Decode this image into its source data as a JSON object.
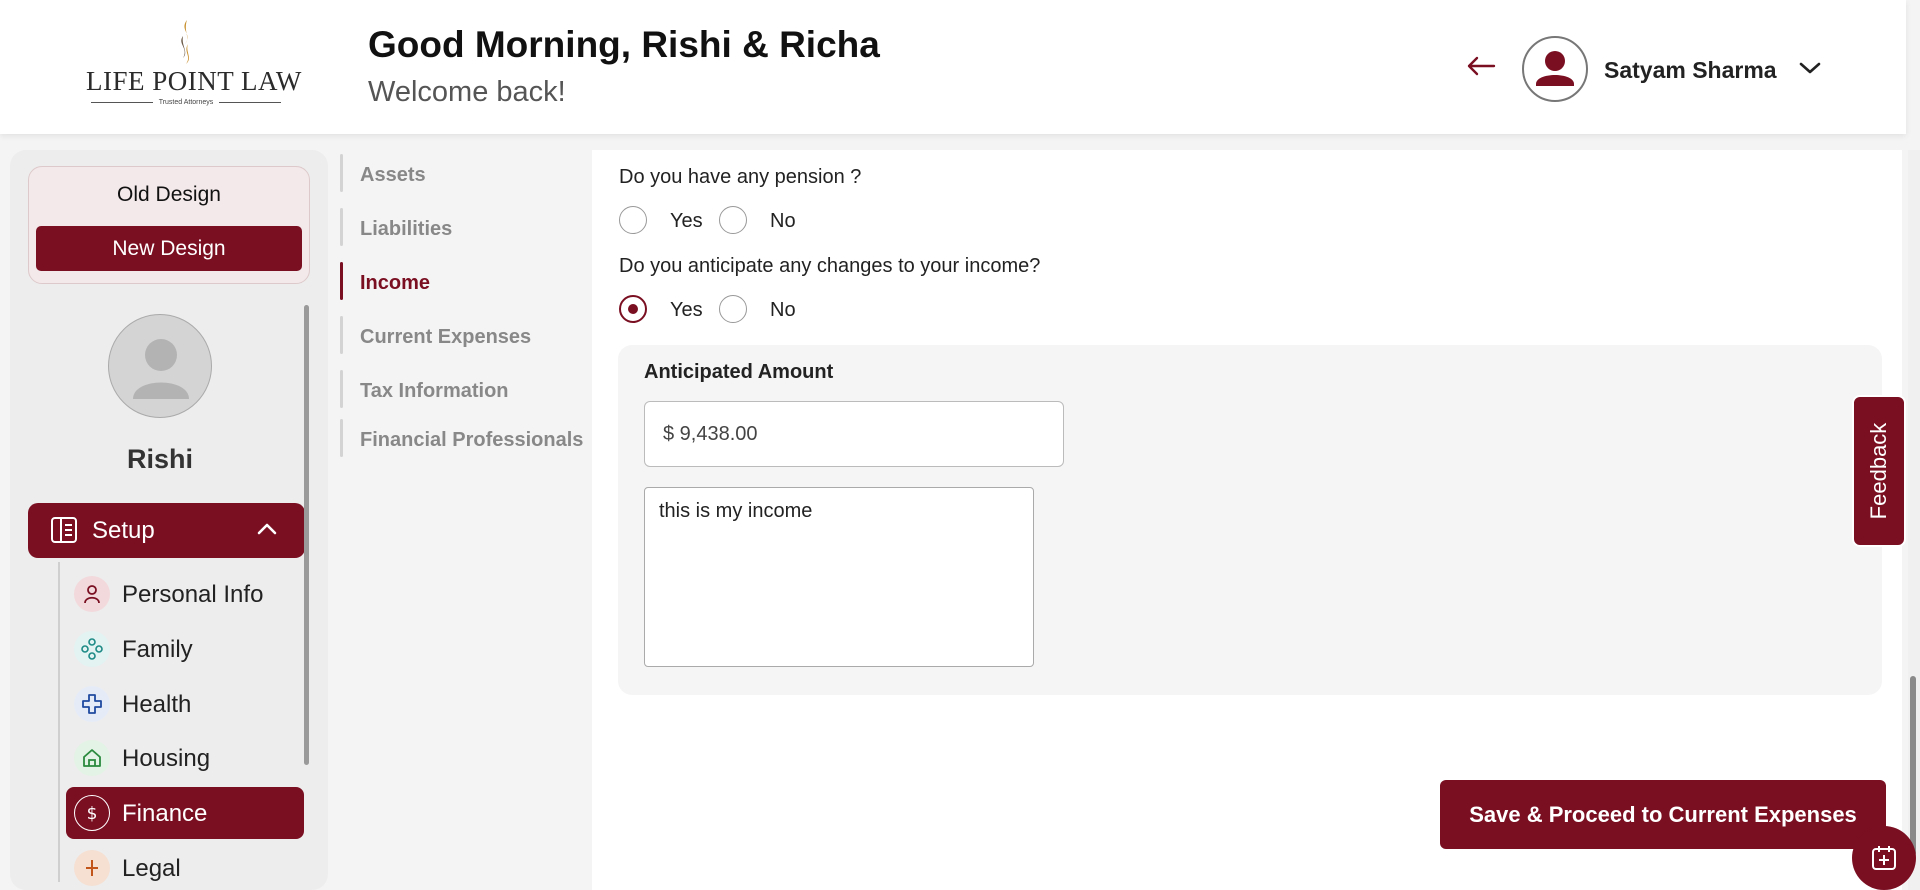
{
  "header": {
    "logo_text": "LIFE POINT LAW",
    "logo_tagline": "Trusted Attorneys",
    "greeting": "Good Morning, Rishi & Richa",
    "welcome": "Welcome back!",
    "user_name": "Satyam Sharma"
  },
  "sidebar": {
    "old_design": "Old Design",
    "new_design": "New Design",
    "profile_name": "Rishi",
    "setup_label": "Setup",
    "items": [
      {
        "label": "Personal Info",
        "icon": "person-icon"
      },
      {
        "label": "Family",
        "icon": "family-icon"
      },
      {
        "label": "Health",
        "icon": "health-cross-icon"
      },
      {
        "label": "Housing",
        "icon": "house-icon"
      },
      {
        "label": "Finance",
        "icon": "dollar-icon",
        "active": true
      },
      {
        "label": "Legal",
        "icon": "legal-icon"
      }
    ]
  },
  "subnav": {
    "items": [
      {
        "label": "Assets"
      },
      {
        "label": "Liabilities"
      },
      {
        "label": "Income",
        "active": true
      },
      {
        "label": "Current Expenses"
      },
      {
        "label": "Tax Information"
      },
      {
        "label": "Financial Professionals"
      }
    ]
  },
  "form": {
    "q1": "Do you have any pension ?",
    "q1_yes": "Yes",
    "q1_no": "No",
    "q2": "Do you anticipate any changes to your income?",
    "q2_yes": "Yes",
    "q2_no": "No",
    "anticipated_title": "Anticipated Amount",
    "amount_value": "$  9,438.00",
    "note_value": "this is my income"
  },
  "actions": {
    "save_label": "Save & Proceed to Current Expenses",
    "feedback_label": "Feedback"
  },
  "colors": {
    "brand": "#7a0f22",
    "background": "#f4f4f4"
  }
}
